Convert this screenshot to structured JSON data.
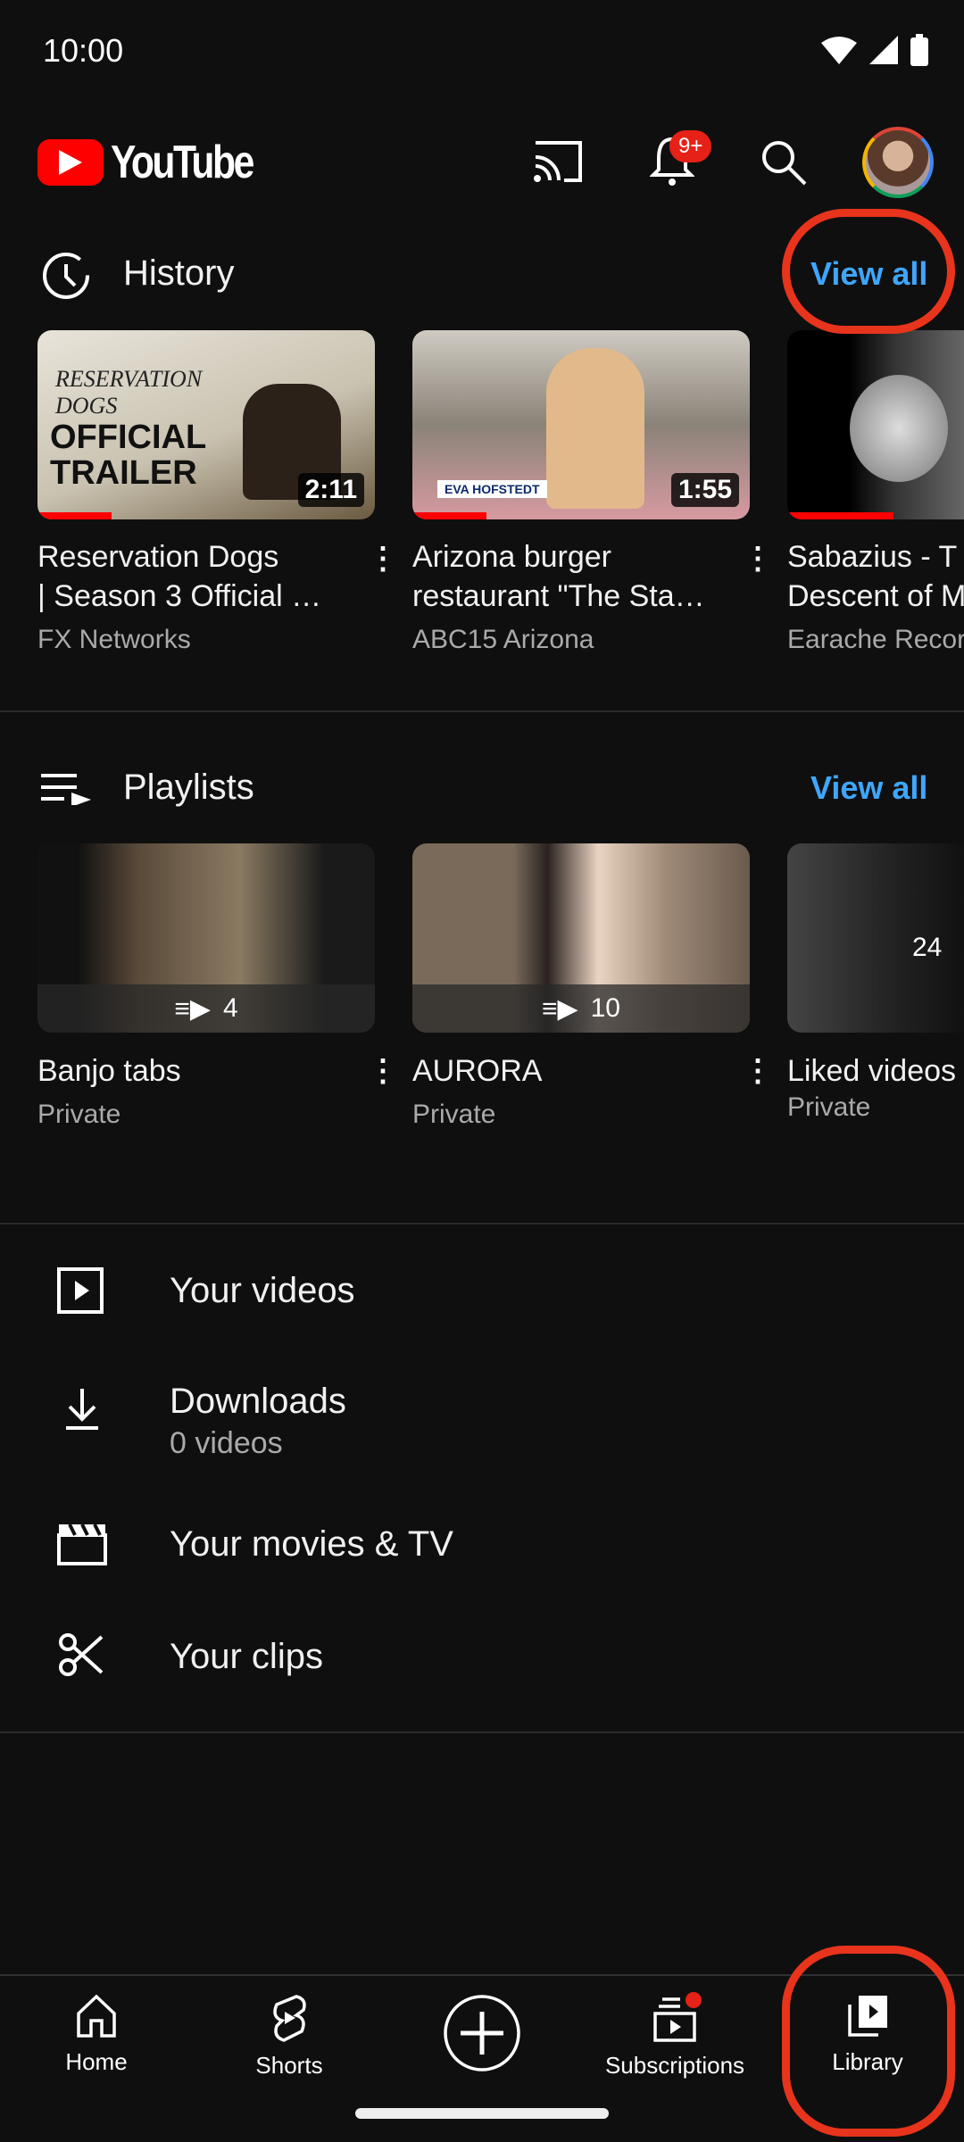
{
  "status": {
    "time": "10:00"
  },
  "header": {
    "logo": "YouTube",
    "notification_badge": "9+",
    "icons": [
      "cast-icon",
      "bell-icon",
      "search-icon",
      "avatar"
    ]
  },
  "history": {
    "title": "History",
    "view_all": "View all",
    "items": [
      {
        "title1": "Reservation Dogs",
        "title2": "| Season 3 Official …",
        "channel": "FX Networks",
        "duration": "2:11",
        "progress": 0.22,
        "thumb_text1": "RESERVATION DOGS",
        "thumb_text2": "OFFICIAL TRAILER"
      },
      {
        "title1": "Arizona burger",
        "title2": "restaurant \"The Sta…",
        "channel": "ABC15 Arizona",
        "duration": "1:55",
        "progress": 0.22,
        "thumb_text1": "EVA HOFSTEDT"
      },
      {
        "title1": "Sabazius - T",
        "title2": "Descent of M",
        "channel": "Earache Recor",
        "progress": 0.6
      }
    ]
  },
  "playlists": {
    "title": "Playlists",
    "view_all": "View all",
    "items": [
      {
        "title": "Banjo tabs",
        "privacy": "Private",
        "count": "4"
      },
      {
        "title": "AURORA",
        "privacy": "Private",
        "count": "10"
      },
      {
        "title": "Liked videos",
        "privacy": "Private",
        "count": "24"
      }
    ]
  },
  "library": [
    {
      "label": "Your videos",
      "icon": "play-square-icon"
    },
    {
      "label": "Downloads",
      "sub": "0 videos",
      "icon": "download-icon"
    },
    {
      "label": "Your movies & TV",
      "icon": "clapperboard-icon"
    },
    {
      "label": "Your clips",
      "icon": "scissors-icon"
    }
  ],
  "nav": [
    {
      "label": "Home"
    },
    {
      "label": "Shorts"
    },
    {
      "label": ""
    },
    {
      "label": "Subscriptions"
    },
    {
      "label": "Library"
    }
  ],
  "colors": {
    "accent": "#3ea6ff",
    "brand": "#ff0000",
    "annotation": "#e8341c"
  }
}
